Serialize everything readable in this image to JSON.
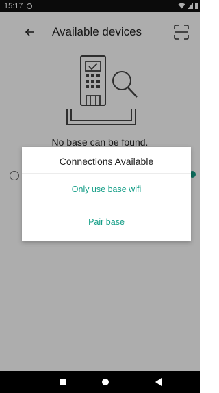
{
  "status_bar": {
    "time": "15:17"
  },
  "app_bar": {
    "title": "Available devices",
    "back_icon": "arrow-left-icon",
    "scan_icon": "scan-frame-icon"
  },
  "main": {
    "empty_message": "No base can be found.",
    "illustration_icon": "payment-terminal-search-icon"
  },
  "dialog": {
    "title": "Connections Available",
    "options": [
      {
        "label": "Only use base wifi"
      },
      {
        "label": "Pair base"
      }
    ]
  },
  "colors": {
    "accent": "#149e87",
    "scrim": "rgba(0,0,0,0.32)",
    "status_bar": "#111111",
    "nav_bar": "#000000"
  },
  "nav_bar": {
    "items": [
      "recents-icon",
      "home-icon",
      "back-icon"
    ]
  }
}
